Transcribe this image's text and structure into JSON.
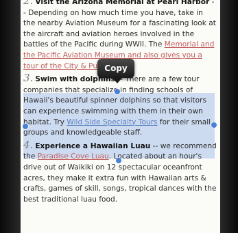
{
  "items": [
    {
      "number": "2.",
      "title": "Visit the Arizona Memorial at Pearl Harbor",
      "separator": " -- ",
      "body_1": "Depending on how much time you have, take in the nearby Aviation Museum for a fascinating look at the aircraft and aviation heroes involved in the battles of the Pacific during WWII. The ",
      "link": "Memorial and the Pacific Aviation Museum and also gives you a tour of the City & Punchbowl",
      "body_2": "."
    },
    {
      "number": "3.",
      "title": "Swim with dolphins",
      "separator": " -- ",
      "body_1": "There are a few tour companies that specialize in finding schools of Hawaii's beautiful spinner dolphins so that visitors can experience swimming with them in their own habitat. Try ",
      "link": "Wild Side Specialty Tours",
      "body_2": " for their small groups and knowledgeable staff."
    },
    {
      "number": "4.",
      "title": "Experience a Hawaiian Luau",
      "separator": " -- ",
      "body_1": "we recommend the ",
      "link": "Paradise Cove Luau",
      "body_2": ". Located about an hour's drive out of Waikiki on 12 spectacular oceanfront acres, they make it extra fun with Hawaiian arts & crafts, games of skill, songs, tropical dances with the best traditional luau food."
    }
  ],
  "popup": {
    "copy_label": "Copy"
  },
  "colors": {
    "selection": "#78a0e6",
    "handle": "#4a7fd6",
    "link": "#c06060"
  }
}
